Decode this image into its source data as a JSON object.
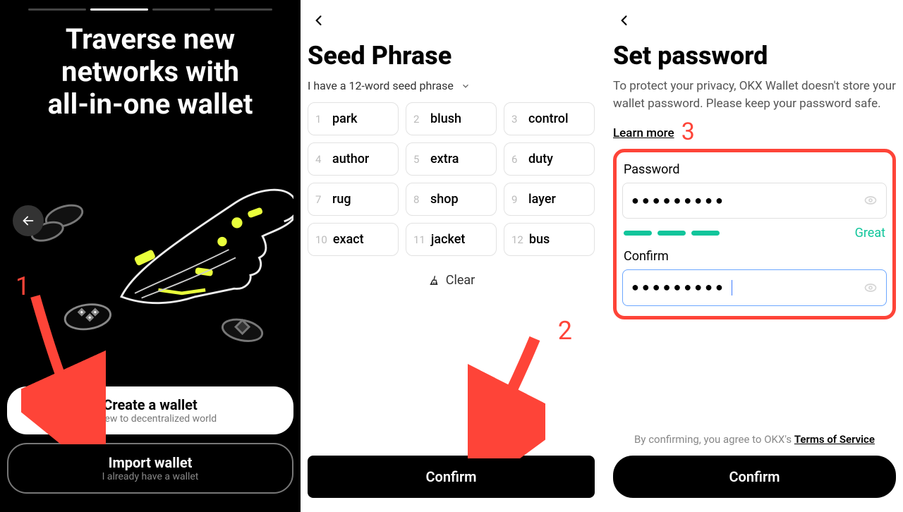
{
  "panel1": {
    "title": "Traverse new\nnetworks with\nall-in-one wallet",
    "create_title": "Create a wallet",
    "create_sub": "I'm new to decentralized world",
    "import_title": "Import wallet",
    "import_sub": "I already have a wallet"
  },
  "panel2": {
    "title": "Seed Phrase",
    "dropdown": "I have a 12-word seed phrase",
    "words": [
      "park",
      "blush",
      "control",
      "author",
      "extra",
      "duty",
      "rug",
      "shop",
      "layer",
      "exact",
      "jacket",
      "bus"
    ],
    "clear": "Clear",
    "confirm": "Confirm"
  },
  "panel3": {
    "title": "Set password",
    "desc_prefix": "To protect your privacy, OKX Wallet doesn't store your wallet password. Please keep your password safe.  ",
    "learn": "Learn more",
    "password_label": "Password",
    "password_value": "●●●●●●●●●",
    "strength": "Great",
    "confirm_label": "Confirm",
    "confirm_value": "●●●●●●●●●",
    "tos_prefix": "By confirming, you agree to OKX's ",
    "tos_link": "Terms of Service",
    "confirm_btn": "Confirm"
  },
  "annotations": {
    "n1": "1",
    "n2": "2",
    "n3": "3"
  }
}
